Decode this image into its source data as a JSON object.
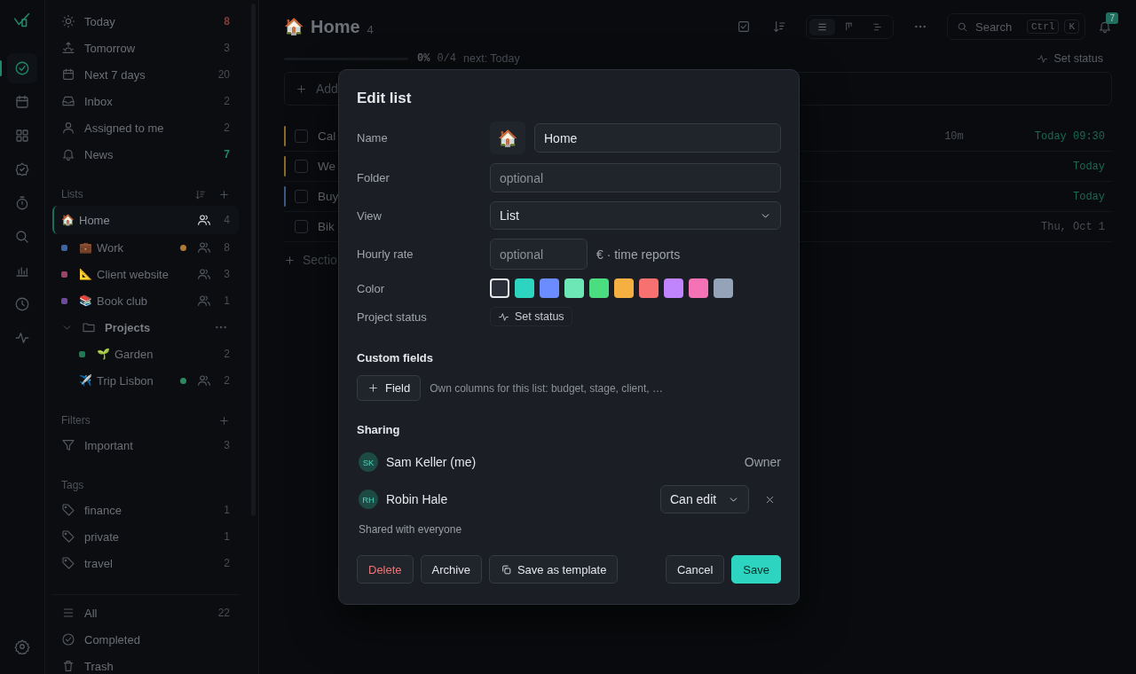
{
  "rail": {
    "items": [
      {
        "kind": "check-circle",
        "selected": true
      },
      {
        "kind": "calendar",
        "selected": false
      },
      {
        "kind": "grid",
        "selected": false
      },
      {
        "kind": "badge-check",
        "selected": false
      },
      {
        "kind": "timer",
        "selected": false
      },
      {
        "kind": "search",
        "selected": false
      },
      {
        "kind": "chart",
        "selected": false
      },
      {
        "kind": "clock",
        "selected": false
      },
      {
        "kind": "pulse",
        "selected": false
      }
    ]
  },
  "sidebar": {
    "smart": [
      {
        "kind": "sun",
        "label": "Today",
        "count": "8",
        "color": "#8a3b3b"
      },
      {
        "kind": "sunrise",
        "label": "Tomorrow",
        "count": "3"
      },
      {
        "kind": "calendar",
        "label": "Next 7 days",
        "count": "20"
      },
      {
        "kind": "inbox",
        "label": "Inbox",
        "count": "2"
      },
      {
        "kind": "user",
        "label": "Assigned to me",
        "count": "2"
      },
      {
        "kind": "bell",
        "label": "News",
        "count": "7",
        "color": "#1f8a6b"
      }
    ],
    "lists_heading": "Lists",
    "lists": [
      {
        "kind": "list",
        "emoji": "🏠",
        "label": "Home",
        "count": "4",
        "shared": true,
        "selected": true
      },
      {
        "kind": "list",
        "color": "#3d64a3",
        "emoji": "💼",
        "label": "Work",
        "status": {
          "color": "#b07a30"
        },
        "count": "8",
        "shared": true,
        "selected": false
      },
      {
        "kind": "list",
        "color": "#9a4468",
        "emoji": "📐",
        "label": "Client website",
        "count": "3",
        "shared": true,
        "selected": false
      },
      {
        "kind": "list",
        "color": "#6e4a9a",
        "emoji": "📚",
        "label": "Book club",
        "count": "1",
        "shared": true,
        "selected": false
      },
      {
        "kind": "folder",
        "label": "Projects",
        "expanded": true,
        "children": [
          {
            "kind": "list",
            "color": "#1e7a55",
            "emoji": "🌱",
            "label": "Garden",
            "count": "2",
            "shared": false,
            "selected": false
          },
          {
            "kind": "list",
            "emoji": "✈️",
            "label": "Trip Lisbon",
            "status": {
              "color": "#2a8a5e"
            },
            "count": "2",
            "shared": true,
            "selected": false
          }
        ]
      }
    ],
    "filters_heading": "Filters",
    "filters": [
      {
        "label": "Important",
        "count": "3"
      }
    ],
    "tags_heading": "Tags",
    "tags": [
      {
        "label": "finance",
        "count": "1"
      },
      {
        "label": "private",
        "count": "1"
      },
      {
        "label": "travel",
        "count": "2"
      }
    ],
    "bottom": [
      {
        "kind": "list-lines",
        "label": "All",
        "count": "22"
      },
      {
        "kind": "check-circle",
        "label": "Completed"
      },
      {
        "kind": "trash",
        "label": "Trash"
      }
    ]
  },
  "main": {
    "emoji": "🏠",
    "title": "Home",
    "count": "4",
    "toolbar": {
      "views": [
        {
          "kind": "list-lines",
          "selected": true
        },
        {
          "kind": "board",
          "selected": false
        },
        {
          "kind": "timeline",
          "selected": false
        }
      ],
      "search": {
        "placeholder": "Search",
        "keys": [
          "Ctrl",
          "K"
        ]
      },
      "notifications": "7"
    },
    "progress": {
      "level": 0,
      "percent": "0%",
      "done": "0/4",
      "next": "next: Today",
      "status_button": "Set status"
    },
    "add_task": "Add",
    "tasks": [
      {
        "color": "#8a6a2a",
        "checked": false,
        "title": "Cal",
        "duration": "10m",
        "due": "Today 09:30",
        "due_highlighted": true
      },
      {
        "color": "#8a6a2a",
        "checked": false,
        "title": "We",
        "due": "Today",
        "due_highlighted": true
      },
      {
        "color": "#3a5a85",
        "checked": false,
        "title": "Buy",
        "due": "Today",
        "due_highlighted": true
      },
      {
        "checked": false,
        "title": "Bik",
        "due": "Thu, Oct 1",
        "due_highlighted": false
      }
    ],
    "add_section": "Sectio"
  },
  "dialog": {
    "title": "Edit list",
    "fields": [
      {
        "kind": "name",
        "label": "Name",
        "emoji": "🏠",
        "value": "Home"
      },
      {
        "kind": "text",
        "label": "Folder",
        "placeholder": "optional"
      },
      {
        "kind": "select",
        "label": "View",
        "value": "List"
      },
      {
        "kind": "rate",
        "label": "Hourly rate",
        "placeholder": "optional",
        "suffix": "€ · time reports"
      },
      {
        "kind": "colors",
        "label": "Color",
        "swatches": [
          {
            "color": "#2a2f3a",
            "selected": true
          },
          {
            "color": "#2dd4bf",
            "selected": false
          },
          {
            "color": "#6b8cff",
            "selected": false
          },
          {
            "color": "#6ee7b7",
            "selected": false
          },
          {
            "color": "#4ade80",
            "selected": false
          },
          {
            "color": "#f5b041",
            "selected": false
          },
          {
            "color": "#f87171",
            "selected": false
          },
          {
            "color": "#c084fc",
            "selected": false
          },
          {
            "color": "#f472b6",
            "selected": false
          },
          {
            "color": "#94a3b8",
            "selected": false
          }
        ]
      },
      {
        "kind": "status",
        "label": "Project status",
        "button": "Set status"
      }
    ],
    "custom_fields": {
      "heading": "Custom fields",
      "button": "Field",
      "hint": "Own columns for this list: budget, stage, client, …"
    },
    "sharing": {
      "heading": "Sharing",
      "members": [
        {
          "kind": "owner",
          "initials": "SK",
          "name": "Sam Keller (me)",
          "role": "Owner"
        },
        {
          "kind": "editor",
          "initials": "RH",
          "name": "Robin Hale",
          "role": "Can edit"
        }
      ],
      "note": "Shared with everyone"
    },
    "buttons_left": [
      {
        "kind": "danger",
        "label": "Delete"
      },
      {
        "kind": "plain",
        "label": "Archive"
      },
      {
        "kind": "template",
        "label": "Save as template"
      }
    ],
    "buttons_right": [
      {
        "kind": "plain",
        "label": "Cancel"
      },
      {
        "kind": "primary",
        "label": "Save"
      }
    ]
  }
}
